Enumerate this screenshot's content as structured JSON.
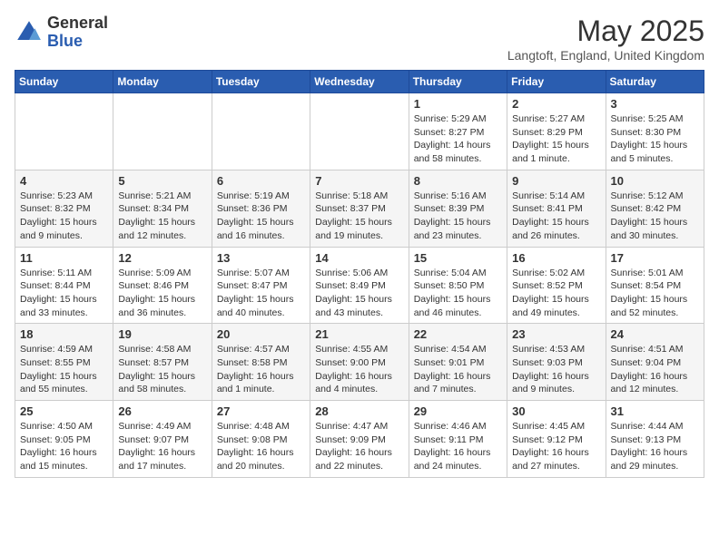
{
  "header": {
    "logo_general": "General",
    "logo_blue": "Blue",
    "month_year": "May 2025",
    "location": "Langtoft, England, United Kingdom"
  },
  "days_of_week": [
    "Sunday",
    "Monday",
    "Tuesday",
    "Wednesday",
    "Thursday",
    "Friday",
    "Saturday"
  ],
  "weeks": [
    [
      {
        "day": "",
        "info": ""
      },
      {
        "day": "",
        "info": ""
      },
      {
        "day": "",
        "info": ""
      },
      {
        "day": "",
        "info": ""
      },
      {
        "day": "1",
        "info": "Sunrise: 5:29 AM\nSunset: 8:27 PM\nDaylight: 14 hours\nand 58 minutes."
      },
      {
        "day": "2",
        "info": "Sunrise: 5:27 AM\nSunset: 8:29 PM\nDaylight: 15 hours\nand 1 minute."
      },
      {
        "day": "3",
        "info": "Sunrise: 5:25 AM\nSunset: 8:30 PM\nDaylight: 15 hours\nand 5 minutes."
      }
    ],
    [
      {
        "day": "4",
        "info": "Sunrise: 5:23 AM\nSunset: 8:32 PM\nDaylight: 15 hours\nand 9 minutes."
      },
      {
        "day": "5",
        "info": "Sunrise: 5:21 AM\nSunset: 8:34 PM\nDaylight: 15 hours\nand 12 minutes."
      },
      {
        "day": "6",
        "info": "Sunrise: 5:19 AM\nSunset: 8:36 PM\nDaylight: 15 hours\nand 16 minutes."
      },
      {
        "day": "7",
        "info": "Sunrise: 5:18 AM\nSunset: 8:37 PM\nDaylight: 15 hours\nand 19 minutes."
      },
      {
        "day": "8",
        "info": "Sunrise: 5:16 AM\nSunset: 8:39 PM\nDaylight: 15 hours\nand 23 minutes."
      },
      {
        "day": "9",
        "info": "Sunrise: 5:14 AM\nSunset: 8:41 PM\nDaylight: 15 hours\nand 26 minutes."
      },
      {
        "day": "10",
        "info": "Sunrise: 5:12 AM\nSunset: 8:42 PM\nDaylight: 15 hours\nand 30 minutes."
      }
    ],
    [
      {
        "day": "11",
        "info": "Sunrise: 5:11 AM\nSunset: 8:44 PM\nDaylight: 15 hours\nand 33 minutes."
      },
      {
        "day": "12",
        "info": "Sunrise: 5:09 AM\nSunset: 8:46 PM\nDaylight: 15 hours\nand 36 minutes."
      },
      {
        "day": "13",
        "info": "Sunrise: 5:07 AM\nSunset: 8:47 PM\nDaylight: 15 hours\nand 40 minutes."
      },
      {
        "day": "14",
        "info": "Sunrise: 5:06 AM\nSunset: 8:49 PM\nDaylight: 15 hours\nand 43 minutes."
      },
      {
        "day": "15",
        "info": "Sunrise: 5:04 AM\nSunset: 8:50 PM\nDaylight: 15 hours\nand 46 minutes."
      },
      {
        "day": "16",
        "info": "Sunrise: 5:02 AM\nSunset: 8:52 PM\nDaylight: 15 hours\nand 49 minutes."
      },
      {
        "day": "17",
        "info": "Sunrise: 5:01 AM\nSunset: 8:54 PM\nDaylight: 15 hours\nand 52 minutes."
      }
    ],
    [
      {
        "day": "18",
        "info": "Sunrise: 4:59 AM\nSunset: 8:55 PM\nDaylight: 15 hours\nand 55 minutes."
      },
      {
        "day": "19",
        "info": "Sunrise: 4:58 AM\nSunset: 8:57 PM\nDaylight: 15 hours\nand 58 minutes."
      },
      {
        "day": "20",
        "info": "Sunrise: 4:57 AM\nSunset: 8:58 PM\nDaylight: 16 hours\nand 1 minute."
      },
      {
        "day": "21",
        "info": "Sunrise: 4:55 AM\nSunset: 9:00 PM\nDaylight: 16 hours\nand 4 minutes."
      },
      {
        "day": "22",
        "info": "Sunrise: 4:54 AM\nSunset: 9:01 PM\nDaylight: 16 hours\nand 7 minutes."
      },
      {
        "day": "23",
        "info": "Sunrise: 4:53 AM\nSunset: 9:03 PM\nDaylight: 16 hours\nand 9 minutes."
      },
      {
        "day": "24",
        "info": "Sunrise: 4:51 AM\nSunset: 9:04 PM\nDaylight: 16 hours\nand 12 minutes."
      }
    ],
    [
      {
        "day": "25",
        "info": "Sunrise: 4:50 AM\nSunset: 9:05 PM\nDaylight: 16 hours\nand 15 minutes."
      },
      {
        "day": "26",
        "info": "Sunrise: 4:49 AM\nSunset: 9:07 PM\nDaylight: 16 hours\nand 17 minutes."
      },
      {
        "day": "27",
        "info": "Sunrise: 4:48 AM\nSunset: 9:08 PM\nDaylight: 16 hours\nand 20 minutes."
      },
      {
        "day": "28",
        "info": "Sunrise: 4:47 AM\nSunset: 9:09 PM\nDaylight: 16 hours\nand 22 minutes."
      },
      {
        "day": "29",
        "info": "Sunrise: 4:46 AM\nSunset: 9:11 PM\nDaylight: 16 hours\nand 24 minutes."
      },
      {
        "day": "30",
        "info": "Sunrise: 4:45 AM\nSunset: 9:12 PM\nDaylight: 16 hours\nand 27 minutes."
      },
      {
        "day": "31",
        "info": "Sunrise: 4:44 AM\nSunset: 9:13 PM\nDaylight: 16 hours\nand 29 minutes."
      }
    ]
  ]
}
